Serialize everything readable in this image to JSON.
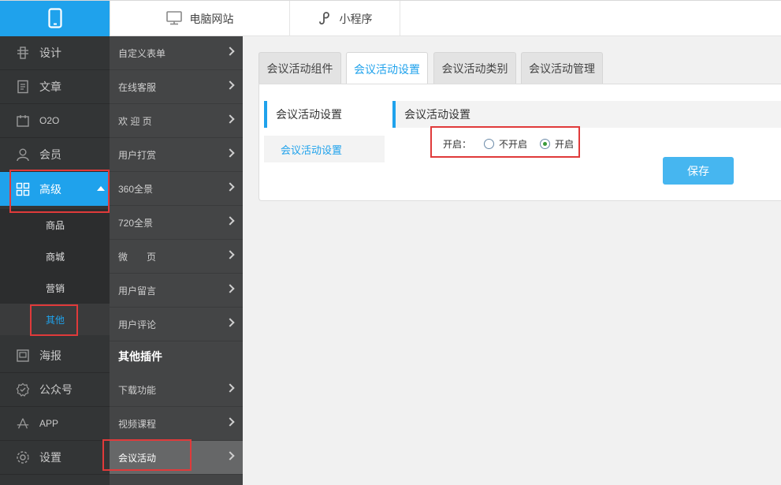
{
  "topbar": {
    "tabs": [
      {
        "label": "电脑网站",
        "icon": "monitor-icon"
      },
      {
        "label": "小程序",
        "icon": "mini-program-icon"
      }
    ]
  },
  "sidebar": {
    "items": [
      {
        "label": "设计",
        "icon": "design-icon"
      },
      {
        "label": "文章",
        "icon": "article-icon"
      },
      {
        "label": "O2O",
        "icon": "o2o-icon"
      },
      {
        "label": "会员",
        "icon": "member-icon"
      },
      {
        "label": "高级",
        "icon": "grid-icon"
      },
      {
        "label": "海报",
        "icon": "poster-icon"
      },
      {
        "label": "公众号",
        "icon": "official-account-icon"
      },
      {
        "label": "APP",
        "icon": "app-icon"
      },
      {
        "label": "设置",
        "icon": "gear-icon"
      }
    ],
    "subitems": [
      "商品",
      "商城",
      "营销",
      "其他"
    ]
  },
  "sidebar2": {
    "items": [
      "自定义表单",
      "在线客服",
      "欢 迎 页",
      "用户打赏",
      "360全景",
      "720全景",
      "微　　页",
      "用户留言",
      "用户评论"
    ],
    "section_title": "其他插件",
    "plugin_items": [
      "下载功能",
      "视频课程",
      "会议活动"
    ]
  },
  "main": {
    "tabs": [
      "会议活动组件",
      "会议活动设置",
      "会议活动类别",
      "会议活动管理"
    ],
    "leftnav_title": "会议活动设置",
    "leftnav_item": "会议活动设置",
    "section_title": "会议活动设置",
    "field_label": "开启：",
    "options": [
      "不开启",
      "开启"
    ],
    "save_label": "保存"
  },
  "colors": {
    "accent": "#1fa2ec",
    "highlight": "#e03a3a"
  }
}
